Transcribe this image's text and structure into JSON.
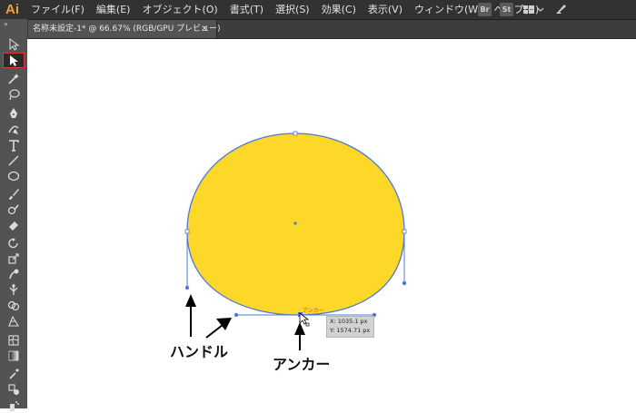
{
  "app": {
    "logo": "Ai"
  },
  "menubar": {
    "items": [
      "ファイル(F)",
      "編集(E)",
      "オブジェクト(O)",
      "書式(T)",
      "選択(S)",
      "効果(C)",
      "表示(V)",
      "ウィンドウ(W)",
      "ヘルプ(H)"
    ],
    "bridge_label": "Br",
    "stock_label": "St"
  },
  "document_tab": {
    "title": "名称未設定-1* @ 66.67% (RGB/GPU プレビュー)",
    "close_glyph": "×"
  },
  "toolbar": {
    "collapse_glyph": "»",
    "selected_tool": "direct-selection-tool"
  },
  "canvas": {
    "shape_fill": "#fdd829",
    "path_color": "#4f78d6",
    "labels": {
      "handle": "ハンドル",
      "anchor": "アンカー"
    },
    "smart_guide_hint": "アンカー",
    "coords": {
      "x": "X: 1035.1 px",
      "y": "Y: 1574.71 px"
    }
  }
}
